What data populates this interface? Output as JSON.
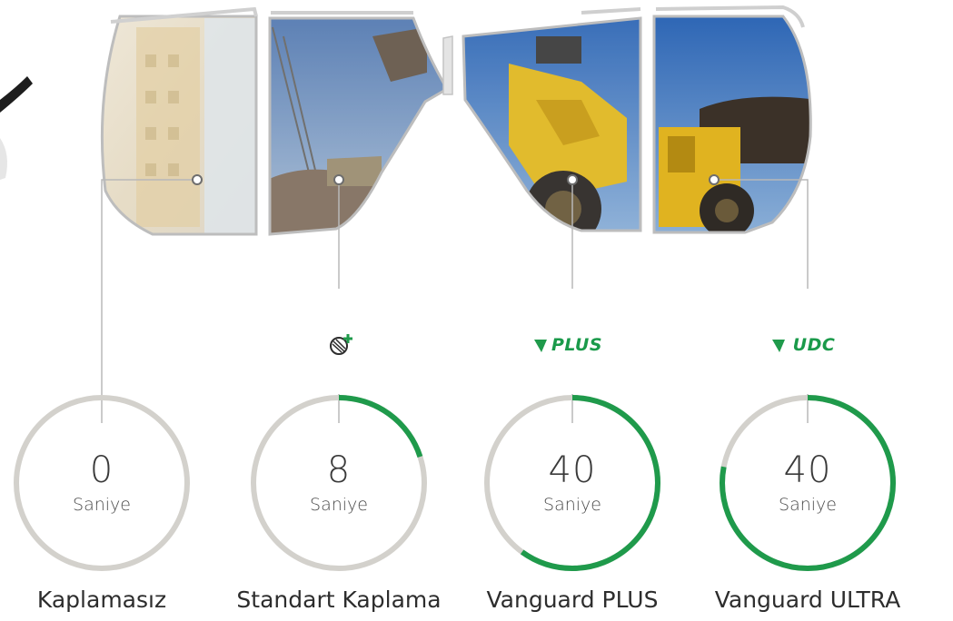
{
  "colors": {
    "accent": "#1f9a4b",
    "track": "#d3d1cc",
    "frame": "#c9c9c9",
    "text": "#2d2d2d"
  },
  "icons": [
    "anti-fog-plus-icon",
    "vanguard-v-logo-icon"
  ],
  "products": [
    {
      "name": "Kaplamasız",
      "brand": "",
      "value": "0",
      "unit": "Saniye",
      "progress": 0.0
    },
    {
      "name": "Standart Kaplama",
      "brand": "",
      "value": "8",
      "unit": "Saniye",
      "progress": 0.2
    },
    {
      "name": "Vanguard PLUS",
      "brand": "PLUS",
      "value": "40",
      "unit": "Saniye",
      "progress": 0.6
    },
    {
      "name": "Vanguard ULTRA",
      "brand": "UDC",
      "value": "40",
      "unit": "Saniye",
      "progress": 0.78
    }
  ]
}
